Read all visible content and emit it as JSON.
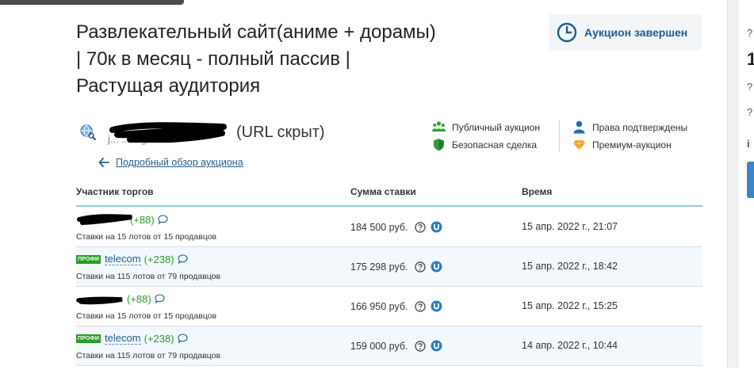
{
  "lot": {
    "title_line1": "Развлекательный сайт(аниме + дорамы)",
    "title_line2": "| 70к в месяц - полный пассив |",
    "title_line3": "Растущая аудитория"
  },
  "status": {
    "label": "Аукцион завершен"
  },
  "url": {
    "hidden_label": "(URL скрыт)",
    "partial_text": "j... ...ie.g..."
  },
  "back_link": {
    "label": "Подробный обзор аукциона"
  },
  "features": [
    {
      "icon": "users-icon",
      "label": "Публичный аукцион",
      "color": "#2e9e3a"
    },
    {
      "icon": "shield-icon",
      "label": "Безопасная сделка",
      "color": "#2e9e3a"
    },
    {
      "icon": "person-icon",
      "label": "Права подтверждены",
      "color": "#1d6fb8"
    },
    {
      "icon": "diamond-icon",
      "label": "Премиум-аукцион",
      "color": "#f0a020"
    }
  ],
  "table": {
    "headers": {
      "bidder": "Участник торгов",
      "amount": "Сумма ставки",
      "time": "Время"
    },
    "rows": [
      {
        "badge": "",
        "name": "",
        "rating": "(+88)",
        "stats": "Ставки на 15 лотов от 15 продавцов",
        "amount": "184 500 руб.",
        "time": "15 апр. 2022 г., 21:07"
      },
      {
        "badge": "ПРОФИ",
        "name": "telecom",
        "rating": "(+238)",
        "stats": "Ставки на 115 лотов от 79 продавцов",
        "amount": "175 298 руб.",
        "time": "15 апр. 2022 г., 18:42"
      },
      {
        "badge": "",
        "name": "",
        "rating": "(+88)",
        "stats": "Ставки на 15 лотов от 15 продавцов",
        "amount": "166 950 руб.",
        "time": "15 апр. 2022 г., 15:25"
      },
      {
        "badge": "ПРОФИ",
        "name": "telecom",
        "rating": "(+238)",
        "stats": "Ставки на 115 лотов от 79 продавцов",
        "amount": "159 000 руб.",
        "time": "14 апр. 2022 г., 10:44"
      }
    ]
  },
  "sidebar": {
    "number_fragment": "1",
    "glyph1": "?",
    "glyph2": "?",
    "glyph3": "?",
    "glyph4": "i"
  },
  "colors": {
    "link": "#1d5f8f",
    "accent_green": "#2e9e3a",
    "row_alt": "#f3f8fc",
    "header_border": "#9cc6e2"
  }
}
